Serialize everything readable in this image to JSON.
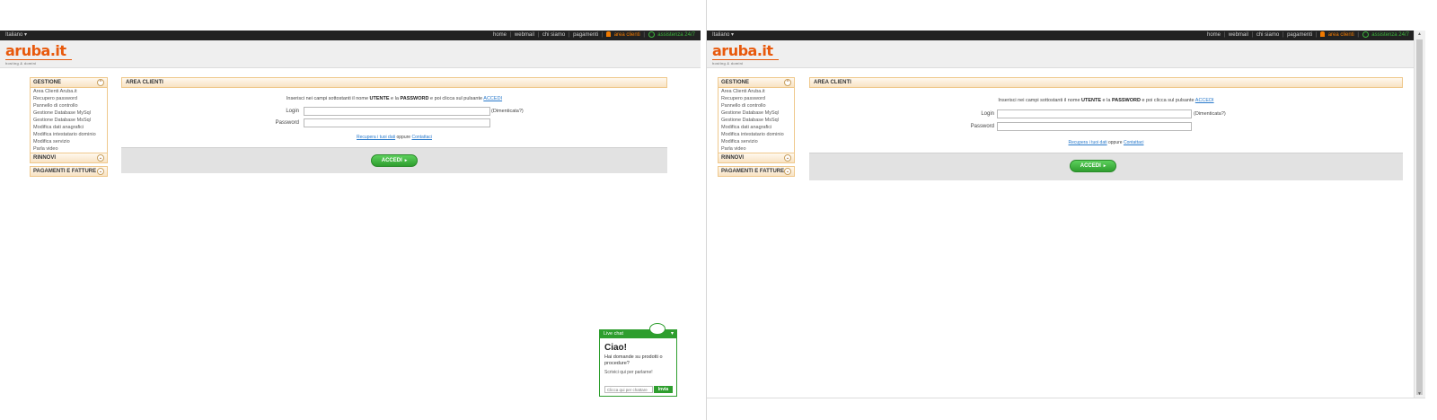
{
  "topbar": {
    "language": "Italiano ▾",
    "links": [
      "home",
      "webmail",
      "chi siamo",
      "pagamenti"
    ],
    "area_clienti": "area clienti",
    "chat": "assistenza 24/7"
  },
  "brand": {
    "logo_main": "aruba",
    "logo_it": ".it",
    "slogan": "hosting & domini"
  },
  "sidebar": {
    "gestione": {
      "title": "GESTIONE",
      "items": [
        "Area Clienti Aruba.it",
        "Recupero password",
        "Pannello di controllo",
        "Gestione Database MySql",
        "Gestione Database MsSql",
        "Modifica dati anagrafici",
        "Modifica intestatario dominio",
        "Modifica servizio",
        "Parla video"
      ]
    },
    "rinnovi": {
      "title": "RINNOVI"
    },
    "pagamenti": {
      "title": "PAGAMENTI E FATTURE"
    }
  },
  "main": {
    "title": "AREA CLIENTI",
    "instruction_pre": "Inserisci nei campi sottostanti il nome ",
    "instruction_utente": "UTENTE",
    "instruction_mid": " e la ",
    "instruction_password": "PASSWORD",
    "instruction_post": " e poi clicca sul pulsante ",
    "instruction_link": "ACCEDI",
    "login_label": "Login",
    "password_label": "Password",
    "forgot": "(Dimenticata?)",
    "recover_link1": "Recupera i tuoi dati",
    "recover_mid": " oppure ",
    "recover_link2": "Contattaci",
    "accedi": "ACCEDI",
    "arrow": "▸"
  },
  "livechat": {
    "title": "Live chat",
    "minimize": "▾",
    "ciao": "Ciao!",
    "question": "Hai domande su prodotti o procedure?",
    "subtitle": "Scrivici qui per parlarne!",
    "placeholder": "Clicca qui per chattare",
    "send": "Invia"
  },
  "scrollbar": {
    "up": "▲",
    "down": "▼"
  },
  "colors": {
    "brand": "#e8590c",
    "accent_green": "#2e9e2e",
    "header_bg": "#222222"
  }
}
